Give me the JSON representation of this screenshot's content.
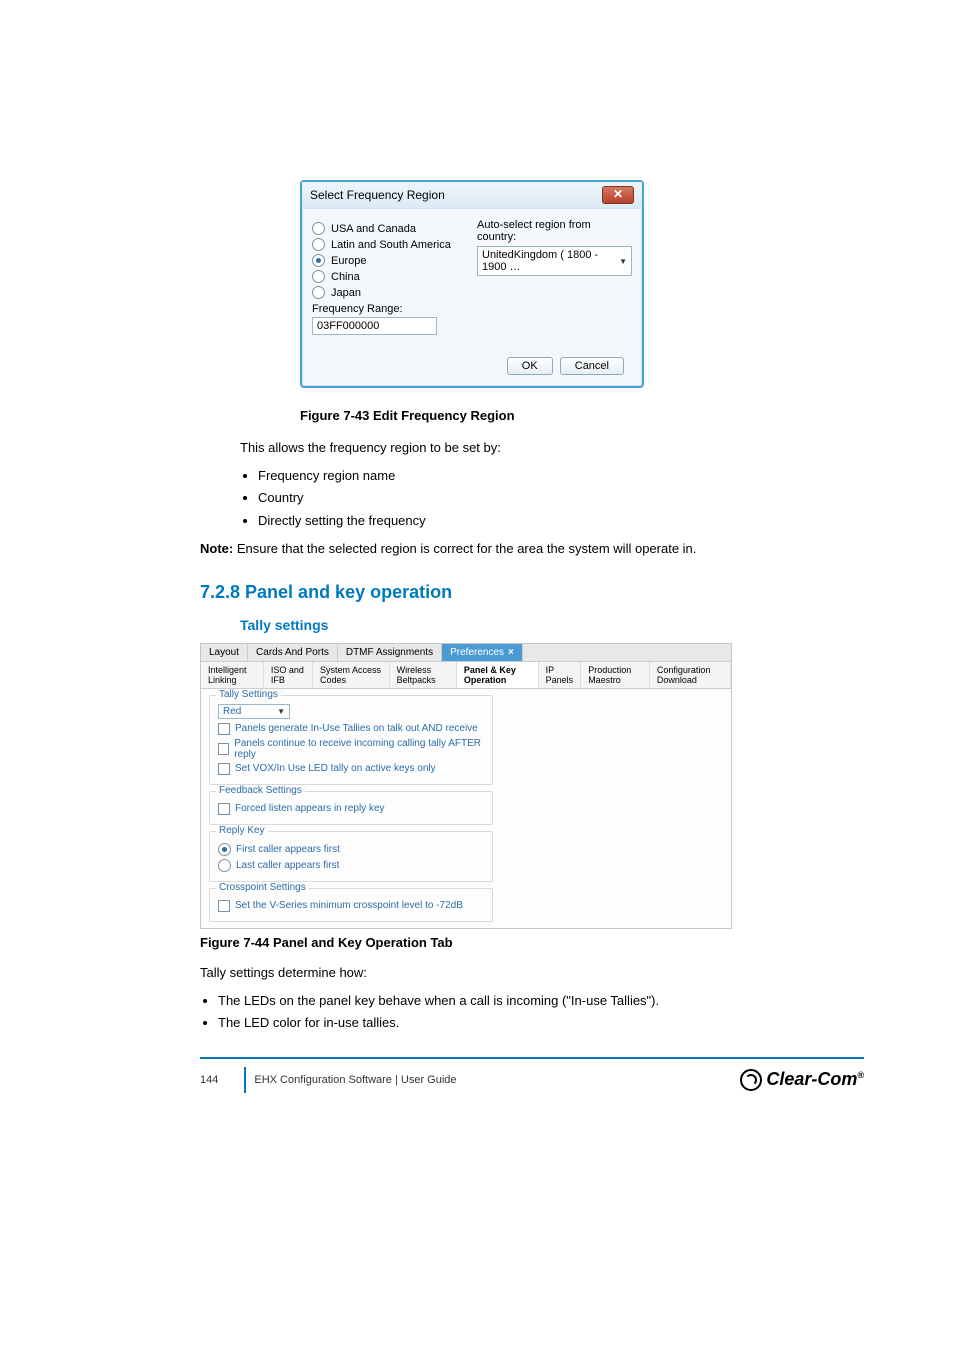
{
  "dialog": {
    "title": "Select Frequency Region",
    "regions": [
      {
        "label": "USA and Canada",
        "selected": false
      },
      {
        "label": "Latin and South America",
        "selected": false
      },
      {
        "label": "Europe",
        "selected": true
      },
      {
        "label": "China",
        "selected": false
      },
      {
        "label": "Japan",
        "selected": false
      }
    ],
    "freq_label": "Frequency Range:",
    "freq_value": "03FF000000",
    "auto_label": "Auto-select region from country:",
    "auto_value": "UnitedKingdom ( 1800 - 1900 …",
    "ok": "OK",
    "cancel": "Cancel"
  },
  "fig1_caption": "Figure 7-43 Edit Frequency Region",
  "region_intro": "This allows the frequency region to be set by:",
  "region_bullets": [
    "Frequency region name",
    "Country",
    "Directly setting the frequency"
  ],
  "note1_label": "Note:",
  "note1_text": " Ensure that the selected region is correct for the area the system will operate in.",
  "section_heading": "7.2.8 Panel and key operation",
  "tally_heading": "Tally settings",
  "tabs_win": {
    "top_tabs": [
      "Layout",
      "Cards And Ports",
      "DTMF Assignments"
    ],
    "active_top": "Preferences",
    "sub_tabs": [
      "Intelligent Linking",
      "ISO and IFB",
      "System Access Codes",
      "Wireless Beltpacks",
      "Panel & Key Operation",
      "IP Panels",
      "Production Maestro",
      "Configuration Download"
    ],
    "active_sub": "Panel & Key Operation",
    "tally_group": "Tally Settings",
    "tally_color": "Red",
    "tally_chks": [
      "Panels generate In-Use Tallies on talk out AND receive",
      "Panels continue to receive incoming calling tally AFTER reply",
      "Set VOX/In Use LED tally on active keys only"
    ],
    "feedback_group": "Feedback Settings",
    "feedback_chk": "Forced listen appears in reply key",
    "reply_group": "Reply Key",
    "reply_opts": [
      {
        "label": "First caller appears first",
        "selected": true
      },
      {
        "label": "Last caller appears first",
        "selected": false
      }
    ],
    "crosspoint_group": "Crosspoint Settings",
    "crosspoint_chk": "Set the V-Series minimum crosspoint level to -72dB"
  },
  "fig2_caption": "Figure 7-44 Panel and Key Operation Tab",
  "tally_intro": "Tally settings determine how:",
  "tally_bullets": [
    "The LEDs on the panel key behave when a call is incoming (\"In-use Tallies\").",
    "The LED color for in-use tallies."
  ],
  "footer": {
    "page": "144",
    "doc": "EHX Configuration Software | User Guide"
  }
}
